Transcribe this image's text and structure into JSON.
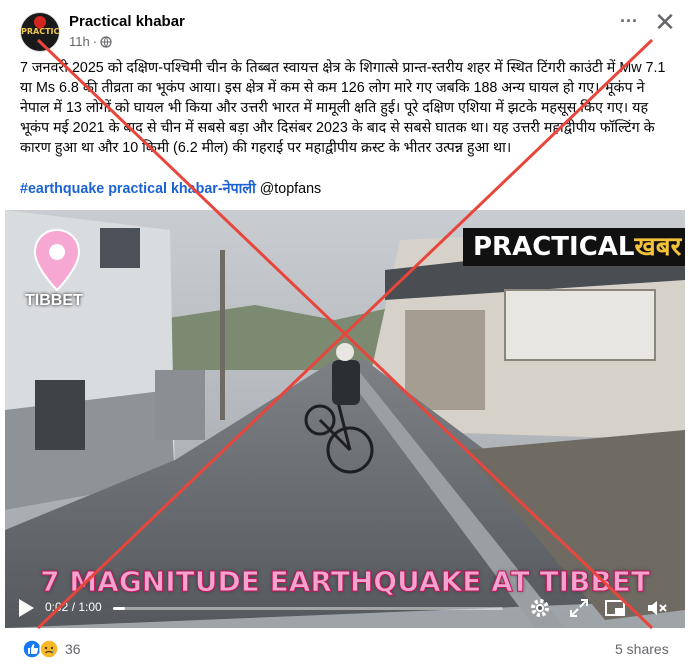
{
  "post": {
    "page_name": "Practical khabar",
    "time": "11h",
    "separator": "·",
    "avatar_text": "PRACTICAL",
    "body": "7 जनवरी 2025 को  दक्षिण-पश्चिमी चीन के तिब्बत स्वायत्त क्षेत्र के शिगात्से प्रान्त-स्तरीय शहर में स्थित टिंगरी काउंटी में Mw 7.1 या Ms 6.8 की तीव्रता का भूकंप आया।  इस क्षेत्र में कम से कम 126 लोग मारे गए जबकि 188 अन्य घायल हो गए। भूकंप ने नेपाल में 13 लोगों को घायल भी किया और उत्तरी भारत में मामूली क्षति हुई। पूरे दक्षिण एशिया में झटके महसूस किए गए। यह भूकंप मई 2021 के बाद से चीन में सबसे बड़ा और दिसंबर 2023 के बाद से सबसे घातक था। यह उत्तरी महाद्वीपीय फॉल्टिंग के कारण हुआ था और 10 किमी (6.2 मील) की गहराई पर महाद्वीपीय क्रस्ट के भीतर उत्पन्न हुआ था।",
    "hashtag": "#earthquake practical khabar-नेपाली",
    "mention": "@topfans"
  },
  "video": {
    "location_label": "TIBBET",
    "brand_prefix": "PRACTICAL",
    "brand_suffix": "खबर",
    "caption": "7 MAGNITUDE EARTHQUAKE AT TIBBET",
    "time_display": "0:02 / 1:00",
    "progress_fraction": 0.03
  },
  "footer": {
    "reaction_count": "36",
    "shares": "5 shares"
  },
  "icons": {
    "globe": "globe-icon",
    "more": "more-options-icon",
    "close": "close-icon",
    "play": "play-icon",
    "settings": "settings-gear-icon",
    "expand": "expand-icon",
    "pip": "picture-in-picture-icon",
    "mute": "volume-muted-icon",
    "pin": "location-pin-icon"
  },
  "colors": {
    "cross": "#e8453c",
    "link": "#1b63d4",
    "caption": "#f2a3cf",
    "brand_accent": "#f3c23b"
  }
}
